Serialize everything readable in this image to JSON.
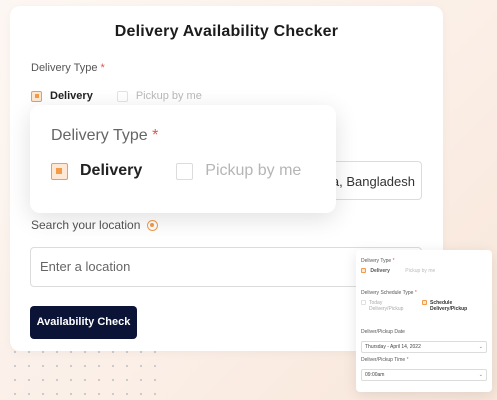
{
  "checker": {
    "title": "Delivery Availability Checker",
    "delivery_type_label": "Delivery Type",
    "required_mark": "*",
    "options": [
      {
        "label": "Delivery",
        "selected": true
      },
      {
        "label": "Pickup by me",
        "selected": false
      }
    ],
    "address_value": "a, Bangladesh",
    "search_label": "Search your location",
    "search_placeholder": "Enter a location",
    "check_button": "Availability Check"
  },
  "popup": {
    "label": "Delivery Type",
    "required_mark": "*",
    "options": [
      {
        "label": "Delivery",
        "selected": true
      },
      {
        "label": "Pickup by me",
        "selected": false
      }
    ]
  },
  "mini_form": {
    "delivery_type_label": "Delivery Type",
    "required_mark": "*",
    "options": [
      {
        "label": "Delivery",
        "selected": true
      },
      {
        "label": "Pickup by me",
        "selected": false
      }
    ],
    "schedule_type_label": "Delivery Schedule Type",
    "schedule_options": [
      {
        "line1": "Today",
        "line2": "Delivery/Pickup",
        "selected": false
      },
      {
        "line1": "Schedule",
        "line2": "Delivery/Pickup",
        "selected": true
      }
    ],
    "date_label": "Deliver/Pickup Date",
    "date_value": "Thursday - April 14, 2022",
    "time_label": "Deliver/Pickup Time",
    "time_value": "09:00am"
  },
  "colors": {
    "accent": "#f29b4a",
    "button_bg": "#0b1437",
    "required": "#e0564c"
  }
}
